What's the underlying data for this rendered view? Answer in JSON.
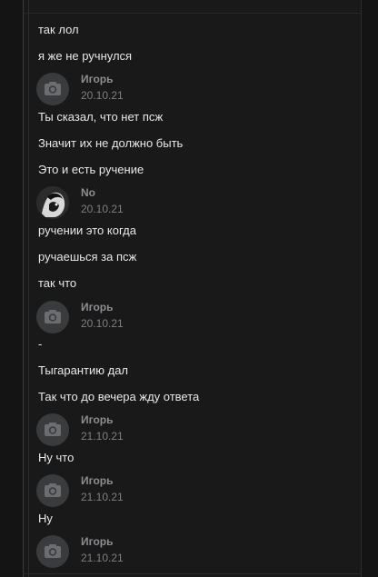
{
  "messages": [
    {
      "type": "text",
      "text": "так лол"
    },
    {
      "type": "text",
      "text": "я же не ручнулся"
    },
    {
      "type": "author",
      "name": "Игорь",
      "date": "20.10.21",
      "avatar": "camera-icon"
    },
    {
      "type": "text",
      "text": "Ты сказал, что нет псж"
    },
    {
      "type": "text",
      "text": "Значит их не должно быть"
    },
    {
      "type": "text",
      "text": "Это и есть ручение"
    },
    {
      "type": "author",
      "name": "No",
      "date": "20.10.21",
      "avatar": "user-photo"
    },
    {
      "type": "text",
      "text": "ручении это когда"
    },
    {
      "type": "text",
      "text": "ручаешься за псж"
    },
    {
      "type": "text",
      "text": "так что"
    },
    {
      "type": "author",
      "name": "Игорь",
      "date": "20.10.21",
      "avatar": "camera-icon"
    },
    {
      "type": "text",
      "text": "-"
    },
    {
      "type": "text",
      "text": "Тыгарантию дал"
    },
    {
      "type": "text",
      "text": "Так что до вечера жду ответа"
    },
    {
      "type": "author",
      "name": "Игорь",
      "date": "21.10.21",
      "avatar": "camera-icon"
    },
    {
      "type": "text",
      "text": "Ну что"
    },
    {
      "type": "author",
      "name": "Игорь",
      "date": "21.10.21",
      "avatar": "camera-icon"
    },
    {
      "type": "text",
      "text": "Ну"
    },
    {
      "type": "author",
      "name": "Игорь",
      "date": "21.10.21",
      "avatar": "camera-icon"
    }
  ]
}
